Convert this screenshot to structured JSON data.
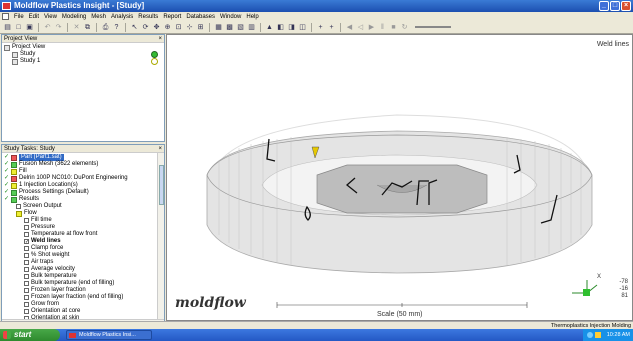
{
  "window": {
    "title": "Moldflow Plastics Insight - [Study]"
  },
  "menu": [
    "File",
    "Edit",
    "View",
    "Modeling",
    "Mesh",
    "Analysis",
    "Results",
    "Report",
    "Databases",
    "Window",
    "Help"
  ],
  "project_view": {
    "title": "Project View",
    "items": [
      {
        "label": "Project View",
        "level": 0,
        "icon": "project-folder-icon"
      },
      {
        "label": "Study",
        "level": 1,
        "icon": "study-icon"
      },
      {
        "label": "Study 1",
        "level": 1,
        "icon": "study-icon"
      }
    ]
  },
  "study_tasks": {
    "title": "Study Tasks: Study",
    "items": [
      {
        "label": "Part (Part1.sat)",
        "kind": "task",
        "selected": true
      },
      {
        "label": "Fusion Mesh (3622 elements)",
        "kind": "task"
      },
      {
        "label": "Fill",
        "kind": "task"
      },
      {
        "label": "Delrin 100P NC010: DuPont Engineering",
        "kind": "task"
      },
      {
        "label": "1 Injection Location(s)",
        "kind": "task"
      },
      {
        "label": "Process Settings (Default)",
        "kind": "task"
      },
      {
        "label": "Results",
        "kind": "folder"
      },
      {
        "label": "Screen Output",
        "kind": "result"
      },
      {
        "label": "Flow",
        "kind": "folder"
      },
      {
        "label": "Fill time",
        "kind": "result"
      },
      {
        "label": "Pressure",
        "kind": "result"
      },
      {
        "label": "Temperature at flow front",
        "kind": "result"
      },
      {
        "label": "Weld lines",
        "kind": "result",
        "checked": true
      },
      {
        "label": "Clamp force",
        "kind": "result"
      },
      {
        "label": "% Shot weight",
        "kind": "result"
      },
      {
        "label": "Air traps",
        "kind": "result"
      },
      {
        "label": "Average velocity",
        "kind": "result"
      },
      {
        "label": "Bulk temperature",
        "kind": "result"
      },
      {
        "label": "Bulk temperature (end of filling)",
        "kind": "result"
      },
      {
        "label": "Frozen layer fraction",
        "kind": "result"
      },
      {
        "label": "Frozen layer fraction (end of filling)",
        "kind": "result"
      },
      {
        "label": "Grow from",
        "kind": "result"
      },
      {
        "label": "Orientation at core",
        "kind": "result"
      },
      {
        "label": "Orientation at skin",
        "kind": "result"
      }
    ]
  },
  "viewport": {
    "result_label": "Weld lines",
    "logo": "moldflow",
    "scale_label": "Scale (50 mm)",
    "axis_values": [
      "-78",
      "-16",
      "81"
    ],
    "axis_x_label": "X"
  },
  "status": {
    "text": "Thermoplastics Injection Molding"
  },
  "taskbar": {
    "start": "start",
    "task": "Moldflow Plastics Insi...",
    "clock": "10:28 AM"
  },
  "colors": {
    "title_blue": "#2458c4",
    "selection": "#316ac5",
    "start_green": "#3c9a3c",
    "part_gray": "#c8c8c8"
  }
}
